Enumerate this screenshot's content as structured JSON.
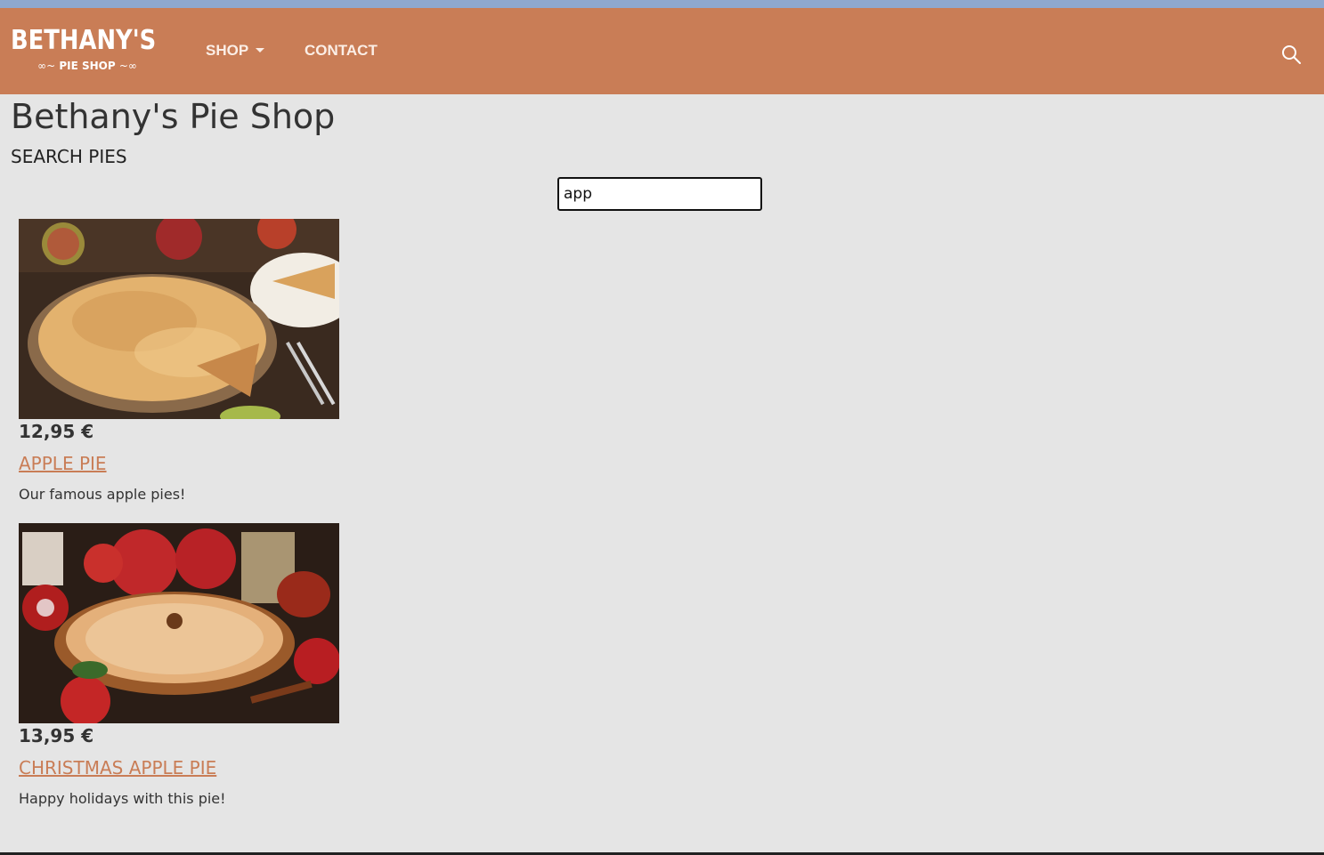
{
  "header": {
    "logo_main": "BETHANY'S",
    "logo_sub": "PIE SHOP",
    "nav": [
      {
        "label": "SHOP",
        "has_dropdown": true
      },
      {
        "label": "CONTACT",
        "has_dropdown": false
      }
    ],
    "search_icon": "search-icon"
  },
  "main": {
    "title": "Bethany's Pie Shop",
    "section_title": "SEARCH PIES",
    "search_value": "app"
  },
  "pies": [
    {
      "price": "12,95 €",
      "name": "APPLE PIE",
      "description": "Our famous apple pies!",
      "image": "apple-pie-photo"
    },
    {
      "price": "13,95 €",
      "name": "CHRISTMAS APPLE PIE",
      "description": "Happy holidays with this pie!",
      "image": "christmas-apple-pie-photo"
    }
  ],
  "colors": {
    "brand": "#c97d56",
    "top_strip": "#8ea8cf",
    "background": "#e5e5e5"
  }
}
